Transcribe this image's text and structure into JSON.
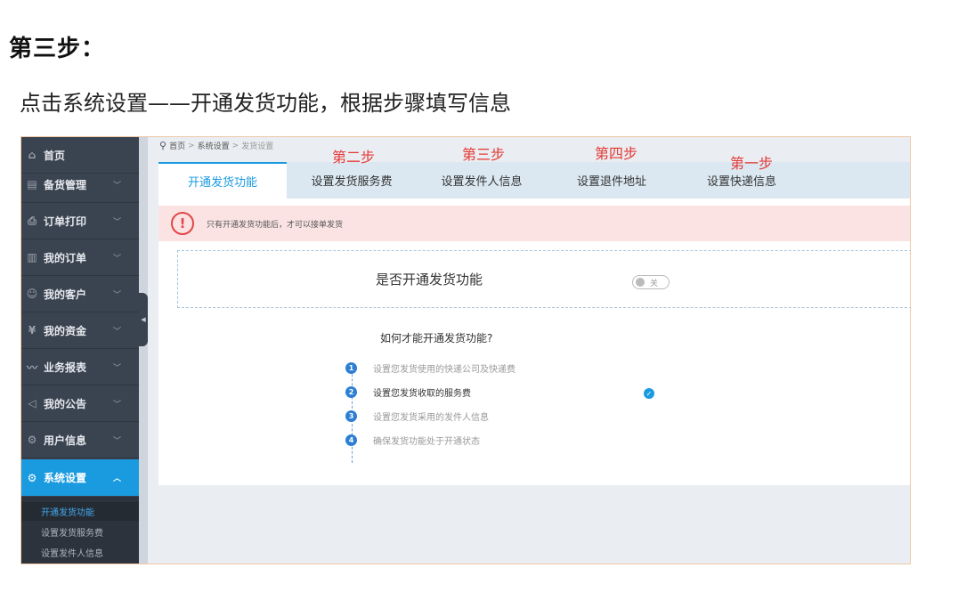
{
  "doc": {
    "heading": "第三步：",
    "instruction": "点击系统设置——开通发货功能，根据步骤填写信息"
  },
  "sidebar": {
    "items": [
      {
        "label": "首页",
        "icon": "home-icon",
        "glyph": "⌂",
        "chevron": ""
      },
      {
        "label": "备货管理",
        "icon": "box-icon",
        "glyph": "▤",
        "chevron": "﹀"
      },
      {
        "label": "订单打印",
        "icon": "printer-icon",
        "glyph": "⎙",
        "chevron": "﹀"
      },
      {
        "label": "我的订单",
        "icon": "document-icon",
        "glyph": "▥",
        "chevron": "﹀"
      },
      {
        "label": "我的客户",
        "icon": "user-icon",
        "glyph": "☺",
        "chevron": "﹀"
      },
      {
        "label": "我的资金",
        "icon": "yen-icon",
        "glyph": "¥",
        "chevron": "﹀"
      },
      {
        "label": "业务报表",
        "icon": "chart-icon",
        "glyph": "〰",
        "chevron": "﹀"
      },
      {
        "label": "我的公告",
        "icon": "speaker-icon",
        "glyph": "◁",
        "chevron": "﹀"
      },
      {
        "label": "用户信息",
        "icon": "gear-icon",
        "glyph": "⚙",
        "chevron": "﹀"
      },
      {
        "label": "系统设置",
        "icon": "settings-icon",
        "glyph": "⚙",
        "chevron": "︿"
      }
    ],
    "active_item": "系统设置",
    "submenu": [
      "开通发货功能",
      "设置发货服务费",
      "设置发件人信息"
    ],
    "active_submenu": "开通发货功能"
  },
  "breadcrumb": {
    "home": "首页",
    "section": "系统设置",
    "current": "发货设置",
    "separator": ">"
  },
  "tabs": [
    "开通发货功能",
    "设置发货服务费",
    "设置发件人信息",
    "设置退件地址",
    "设置快递信息"
  ],
  "active_tab": "开通发货功能",
  "step_annotations": {
    "tab2": "第二步",
    "tab3": "第三步",
    "tab4": "第四步",
    "tab5": "第一步"
  },
  "alert": {
    "icon_glyph": "!",
    "text": "只有开通发货功能后，才可以接单发货"
  },
  "toggle": {
    "label": "是否开通发货功能",
    "state_text": "关",
    "on": false
  },
  "howto": {
    "title": "如何才能开通发货功能?",
    "steps": [
      {
        "num": "1",
        "text": "设置您发货使用的快递公司及快递费",
        "done": false
      },
      {
        "num": "2",
        "text": "设置您发货收取的服务费",
        "done": true
      },
      {
        "num": "3",
        "text": "设置您发货采用的发件人信息",
        "done": false
      },
      {
        "num": "4",
        "text": "确保发货功能处于开通状态",
        "done": false
      }
    ],
    "check_glyph": "✓"
  },
  "colors": {
    "accent": "#1a9be0",
    "sidebar_bg": "#3a4350",
    "annotation_red": "#e53935",
    "alert_bg": "#fbe3e3"
  },
  "ui_glyphs": {
    "pin": "⚲",
    "collapse": "◀"
  }
}
